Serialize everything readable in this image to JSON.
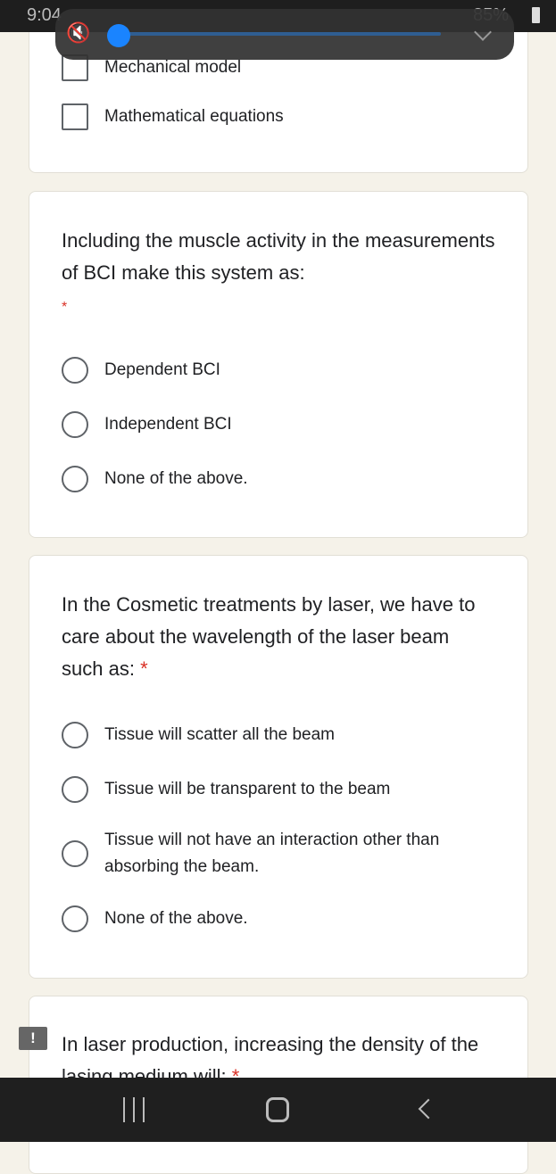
{
  "status_bar": {
    "time": "9:04",
    "battery": "85%"
  },
  "volume_panel": {
    "level": 0,
    "muted": true,
    "accent": "#1a73e8"
  },
  "cards": [
    {
      "options": [
        "Mechanical model",
        "Mathematical equations"
      ],
      "type": "checkbox"
    },
    {
      "question": "Including the muscle activity in the measurements of BCI make this system as:",
      "required": "*",
      "type": "radio",
      "options": [
        "Dependent BCI",
        "Independent BCI",
        "None of the above."
      ]
    },
    {
      "question": "In the Cosmetic treatments by laser, we have to care about the wavelength of the laser beam such as:",
      "required": "*",
      "type": "radio",
      "options": [
        "Tissue will scatter all the beam",
        "Tissue will be transparent to the beam",
        "Tissue will not have an interaction other than absorbing the beam.",
        "None of the above."
      ]
    },
    {
      "question": "In laser production, increasing the density of the lasing medium will:",
      "required": "*",
      "type": "radio"
    }
  ],
  "alert_icon": "!"
}
